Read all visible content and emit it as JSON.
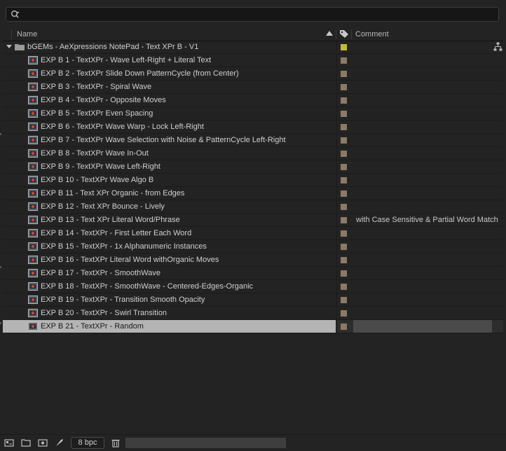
{
  "search": {
    "placeholder": "",
    "value": "",
    "icon": "search-icon"
  },
  "header": {
    "name_label": "Name",
    "comment_label": "Comment",
    "sort": "ascending"
  },
  "colors": {
    "folder_label": "#c2bb3a",
    "comp_label": "#8a7b66",
    "selected_row": "#b4b4b4"
  },
  "folder": {
    "name": "bGEMs - AeXpressions NotePad - Text XPr B - V1",
    "expanded": true
  },
  "items": [
    {
      "name": "EXP B 1 - TextXPr - Wave Left-Right + Literal Text",
      "comment": ""
    },
    {
      "name": "EXP B 2 - TextXPr Slide Down PatternCycle (from Center)",
      "comment": ""
    },
    {
      "name": "EXP B 3 - TextXPr - Spiral Wave",
      "comment": ""
    },
    {
      "name": "EXP B 4 - TextXPr - Opposite Moves",
      "comment": ""
    },
    {
      "name": "EXP B 5 - TextXPr Even Spacing",
      "comment": ""
    },
    {
      "name": "EXP B 6 - TextXPr Wave Warp - Lock Left-Right",
      "comment": ""
    },
    {
      "name": "EXP B 7 - TextXPr Wave Selection with Noise & PatternCycle Left-Right",
      "comment": ""
    },
    {
      "name": "EXP B 8 - TextXPr Wave In-Out",
      "comment": ""
    },
    {
      "name": "EXP B 9 - TextXPr Wave Left-Right",
      "comment": ""
    },
    {
      "name": "EXP B 10 - TextXPr Wave Algo B",
      "comment": ""
    },
    {
      "name": "EXP B 11 - Text XPr Organic - from Edges",
      "comment": ""
    },
    {
      "name": "EXP B 12 - Text XPr Bounce - Lively",
      "comment": ""
    },
    {
      "name": "EXP B 13 - Text XPr Literal Word/Phrase",
      "comment": "with Case Sensitive & Partial Word Match"
    },
    {
      "name": "EXP B 14 - TextXPr - First Letter Each Word",
      "comment": ""
    },
    {
      "name": "EXP B 15 - TextXPr - 1x Alphanumeric Instances",
      "comment": ""
    },
    {
      "name": "EXP B 16 - TextXPr Literal Word withOrganic Moves",
      "comment": ""
    },
    {
      "name": "EXP B 17 - TextXPr - SmoothWave",
      "comment": ""
    },
    {
      "name": "EXP B 18 - TextXPr - SmoothWave - Centered-Edges-Organic",
      "comment": ""
    },
    {
      "name": "EXP B 19 - TextXPr - Transition Smooth Opacity",
      "comment": ""
    },
    {
      "name": "EXP B 20 - TextXPr - Swirl Transition",
      "comment": ""
    },
    {
      "name": "EXP B 21 - TextXPr - Random",
      "comment": "",
      "selected": true
    }
  ],
  "footer": {
    "bpc_label": "8 bpc"
  }
}
